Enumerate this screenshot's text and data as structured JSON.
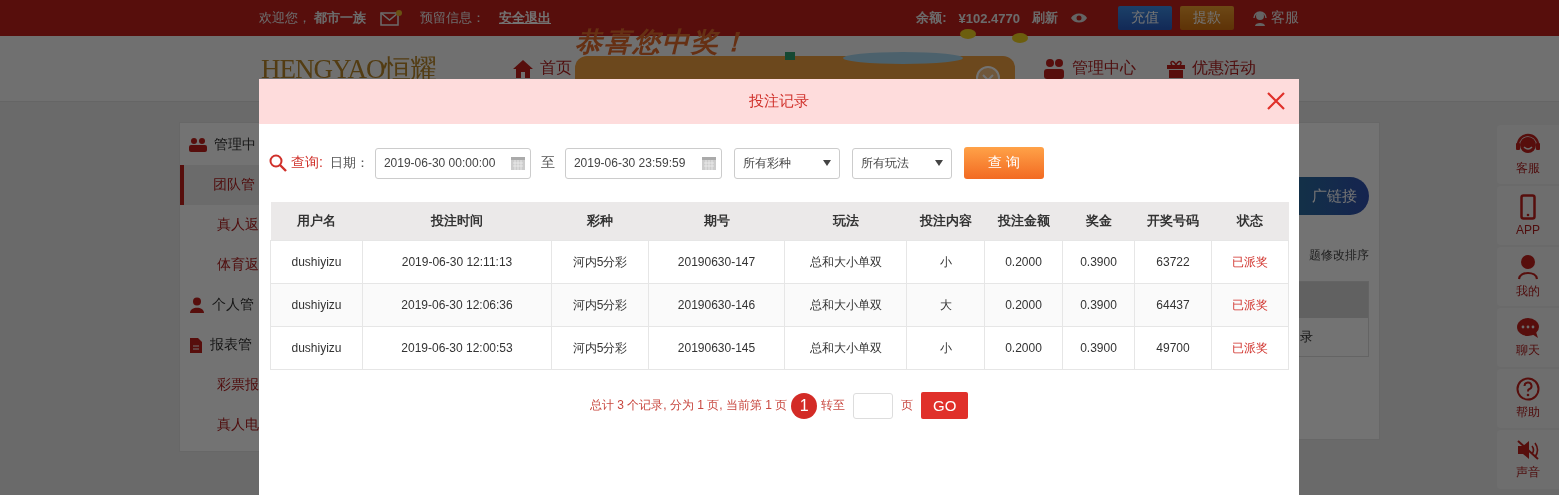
{
  "top_bar": {
    "welcome": "欢迎您，",
    "username": "都市一族",
    "reserved_label": "预留信息：",
    "logout": "安全退出",
    "balance_label": "余额:",
    "balance": "¥102.4770",
    "refresh": "刷新",
    "deposit": "充值",
    "withdraw": "提款",
    "service": "客服"
  },
  "promo": {
    "title": "恭喜您中奖！"
  },
  "nav": {
    "logo": "HENGYAO恒耀",
    "items": [
      {
        "label": "首页"
      },
      {
        "label": "管理中心"
      },
      {
        "label": "优惠活动"
      }
    ]
  },
  "sidebar": {
    "items": [
      {
        "kind": "header",
        "label": "管理中"
      },
      {
        "kind": "link",
        "label": "团队管",
        "selected": true
      },
      {
        "kind": "link",
        "label": "真人返",
        "selected": false
      },
      {
        "kind": "link",
        "label": "体育返",
        "selected": false
      },
      {
        "kind": "header",
        "label": "个人管"
      },
      {
        "kind": "header",
        "label": "报表管"
      },
      {
        "kind": "link",
        "label": "彩票报",
        "selected": false
      },
      {
        "kind": "link",
        "label": "真人电",
        "selected": false
      }
    ]
  },
  "right_panel": {
    "promote_button": "广链接",
    "hint": "题修改排序",
    "row_text": "录"
  },
  "float_bar": [
    {
      "label": "客服"
    },
    {
      "label": "APP"
    },
    {
      "label": "我的"
    },
    {
      "label": "聊天"
    },
    {
      "label": "帮助"
    },
    {
      "label": "声音"
    }
  ],
  "modal": {
    "title": "投注记录",
    "query": {
      "label": "查询:",
      "date_label": "日期：",
      "start": "2019-06-30 00:00:00",
      "to": "至",
      "end": "2019-06-30 23:59:59",
      "lottery": "所有彩种",
      "play": "所有玩法",
      "button": "查 询"
    },
    "table": {
      "columns": [
        "用户名",
        "投注时间",
        "彩种",
        "期号",
        "玩法",
        "投注内容",
        "投注金额",
        "奖金",
        "开奖号码",
        "状态"
      ],
      "rows": [
        [
          "dushiyizu",
          "2019-06-30 12:11:13",
          "河内5分彩",
          "20190630-147",
          "总和大小单双",
          "小",
          "0.2000",
          "0.3900",
          "63722",
          "已派奖"
        ],
        [
          "dushiyizu",
          "2019-06-30 12:06:36",
          "河内5分彩",
          "20190630-146",
          "总和大小单双",
          "大",
          "0.2000",
          "0.3900",
          "64437",
          "已派奖"
        ],
        [
          "dushiyizu",
          "2019-06-30 12:00:53",
          "河内5分彩",
          "20190630-145",
          "总和大小单双",
          "小",
          "0.2000",
          "0.3900",
          "49700",
          "已派奖"
        ]
      ]
    },
    "pagination": {
      "summary": "总计 3 个记录, 分为 1 页, 当前第 1 页",
      "current": "1",
      "goto": "转至",
      "unit": "页",
      "button": "GO"
    }
  }
}
